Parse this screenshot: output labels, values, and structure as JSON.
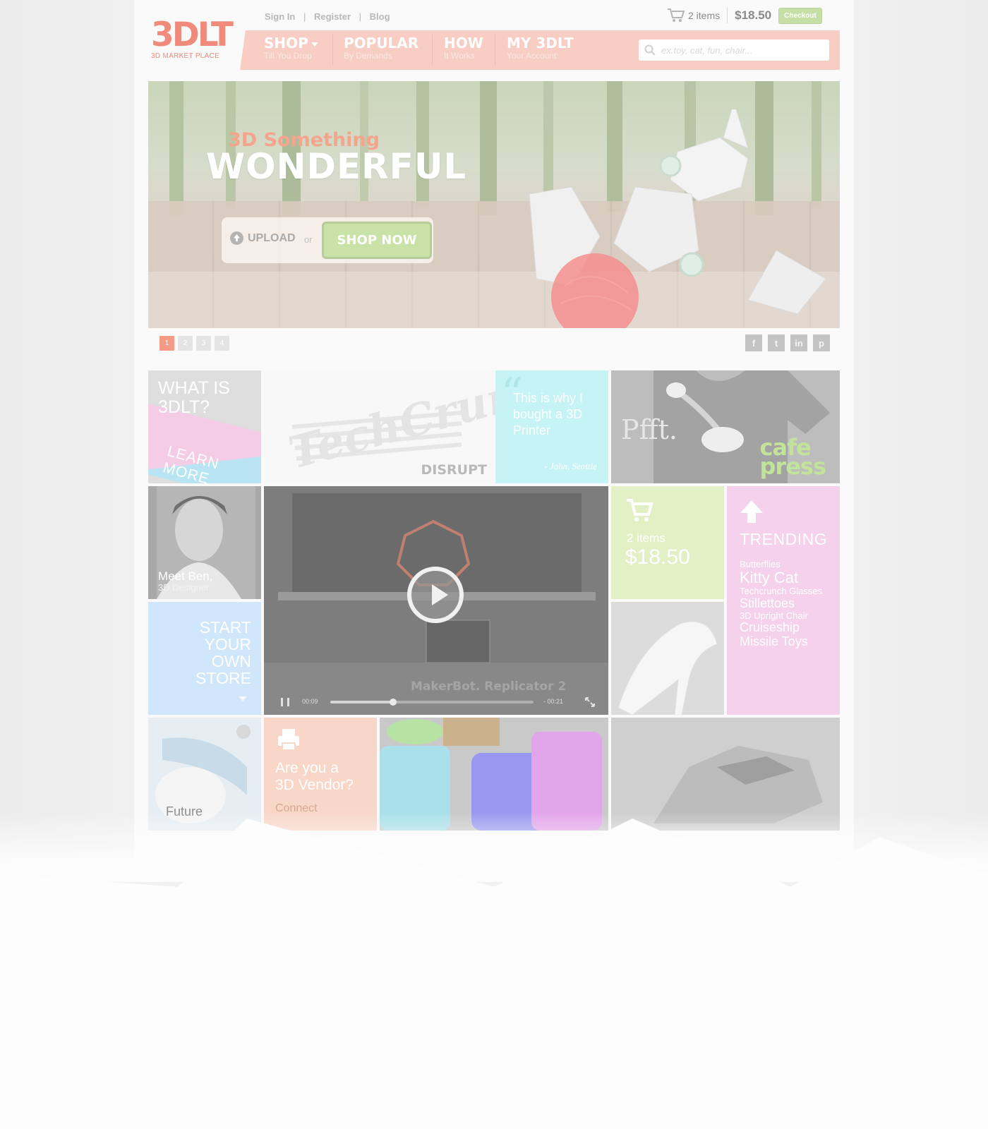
{
  "logo": {
    "mark": "3DLT",
    "subtitle": "3D MARKET PLACE"
  },
  "toplinks": {
    "sign_in": "Sign In",
    "register": "Register",
    "blog": "Blog",
    "separator": "|"
  },
  "cart_top": {
    "items": "2 items",
    "total": "$18.50",
    "checkout": "Checkout"
  },
  "nav": {
    "items": [
      {
        "title": "SHOP",
        "subtitle": "Till You Drop"
      },
      {
        "title": "POPULAR",
        "subtitle": "By Demands"
      },
      {
        "title": "HOW",
        "subtitle": "It Works"
      },
      {
        "title": "MY 3DLT",
        "subtitle": "Your Account"
      }
    ],
    "search_placeholder": "ex.toy, cat, fun, chair..."
  },
  "hero": {
    "subtitle": "3D Something",
    "title": "WONDERFUL",
    "upload": "UPLOAD",
    "or": "or",
    "shop_now": "SHOP NOW"
  },
  "slider": {
    "pages": [
      "1",
      "2",
      "3",
      "4"
    ],
    "active": 1
  },
  "social": {
    "facebook": "f",
    "twitter": "t",
    "linkedin": "in",
    "pinterest": "p"
  },
  "tiles": {
    "what": {
      "line1": "WHAT IS",
      "line2": "3DLT?",
      "learn_more": "LEARN MORE"
    },
    "techcrunch": {
      "logo": "TechCrunch",
      "disrupt": "DISRUPT"
    },
    "quote": {
      "text": "This is why I bought a 3D Printer",
      "author": "- John, Seattle"
    },
    "cafepress": {
      "pfft": "Pfft.",
      "brand_line1": "cafe",
      "brand_line2": "press"
    },
    "ben": {
      "name": "Meet Ben,",
      "role": "3D Designer"
    },
    "video": {
      "brand": "MakerBot. Replicator 2",
      "time_elapsed": "00:09",
      "time_remaining": "- 00:21",
      "progress": 0.31
    },
    "cart": {
      "items": "2 items",
      "total": "$18.50"
    },
    "trending": {
      "title": "TRENDING",
      "items": [
        "Butterflies",
        "Kitty Cat",
        "Techcrunch Glasses",
        "Stillettoes",
        "3D Upright Chair",
        "Cruiseship",
        "Missile Toys"
      ]
    },
    "store": {
      "line1": "START",
      "line2": "YOUR",
      "line3": "OWN",
      "line4": "STORE"
    },
    "future": {
      "text": "Future"
    },
    "vendor": {
      "line1": "Are you a",
      "line2": "3D Vendor?",
      "connect": "Connect"
    }
  },
  "colors": {
    "accent": "#f08a7a",
    "nav_bg": "#f7cdc4",
    "checkout": "#c6dfa7",
    "quote_tile": "#c6f3f5",
    "cart_tile": "#e2f0c6",
    "trending_tile": "#f6d1ec",
    "store_tile": "#d0e7fb",
    "vendor_tile": "#f8d7c9"
  }
}
